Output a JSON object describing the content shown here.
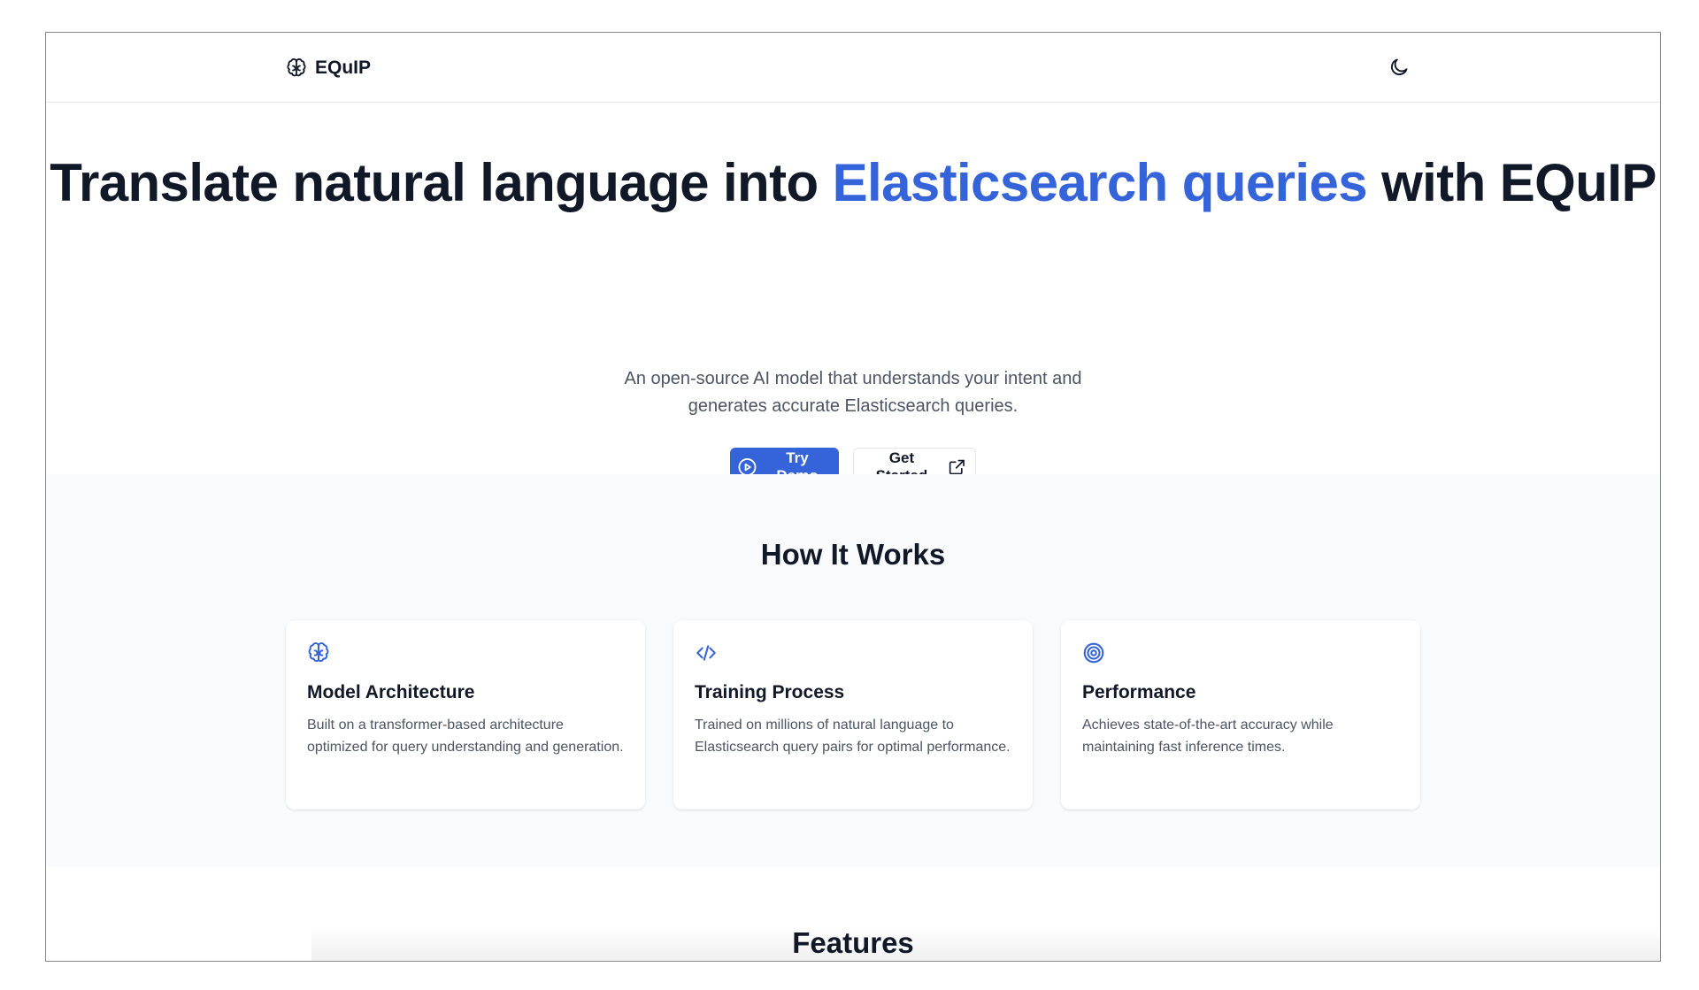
{
  "header": {
    "brand_name": "EQuIP",
    "brand_icon": "brain-icon",
    "theme_toggle_icon": "moon-icon"
  },
  "hero": {
    "title_part1": "Translate natural language into ",
    "title_accent": "Elasticsearch queries",
    "title_part2": " with EQuIP",
    "subtitle_line1": "An open-source AI model that understands your intent and",
    "subtitle_line2": "generates accurate Elasticsearch queries.",
    "primary_button": {
      "label": "Try Demo",
      "icon": "play-circle-icon"
    },
    "secondary_button": {
      "label": "Get Started",
      "icon": "external-link-icon"
    }
  },
  "how_it_works": {
    "title": "How It Works",
    "cards": [
      {
        "icon": "brain-icon",
        "title": "Model Architecture",
        "description": "Built on a transformer-based architecture optimized for query understanding and generation."
      },
      {
        "icon": "code-icon",
        "title": "Training Process",
        "description": "Trained on millions of natural language to Elasticsearch query pairs for optimal performance."
      },
      {
        "icon": "target-icon",
        "title": "Performance",
        "description": "Achieves state-of-the-art accuracy while maintaining fast inference times."
      }
    ]
  },
  "features": {
    "title": "Features"
  },
  "colors": {
    "accent": "#3563d9",
    "text_primary": "#111827",
    "text_secondary": "#4b5563",
    "section_bg": "#f9fafb"
  }
}
